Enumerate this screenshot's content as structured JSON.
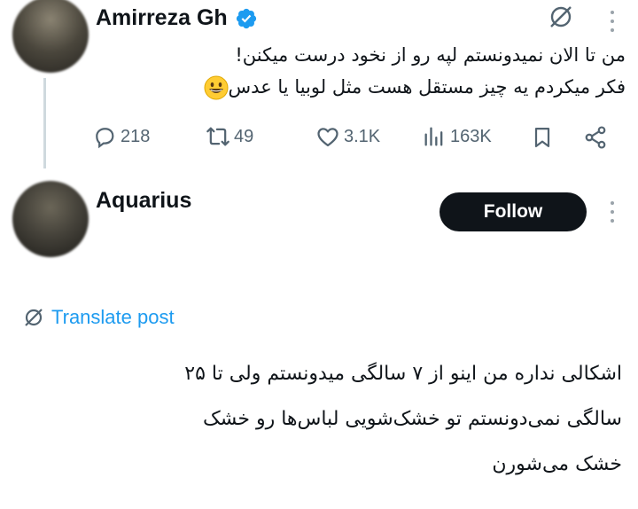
{
  "tweet": {
    "author_name": "Amirreza Gh",
    "verified_icon": "verified-badge-icon",
    "text_line_1": "من تا الان نمیدونستم لپه رو از نخود درست میکنن!",
    "text_line_2": "فکر میکردم یه چیز مستقل هست مثل لوبیا یا عدس",
    "emoji": "grinning-face-emoji",
    "stats": {
      "replies": "218",
      "reposts": "49",
      "likes": "3.1K",
      "views": "163K"
    }
  },
  "reply": {
    "author_name": "Aquarius",
    "follow_label": "Follow",
    "translate_label": "Translate post",
    "text_lines": [
      "اشکالی نداره من اینو از ۷ سالگی میدونستم ولی تا ۲۵",
      "سالگی نمی‌دونستم تو خشک‌شویی لباس‌ها رو خشک",
      "خشک می‌شورن"
    ]
  },
  "colors": {
    "accent": "#1d9bf0",
    "text": "#0f1419",
    "muted": "#536471",
    "follow_bg": "#0f1419"
  }
}
